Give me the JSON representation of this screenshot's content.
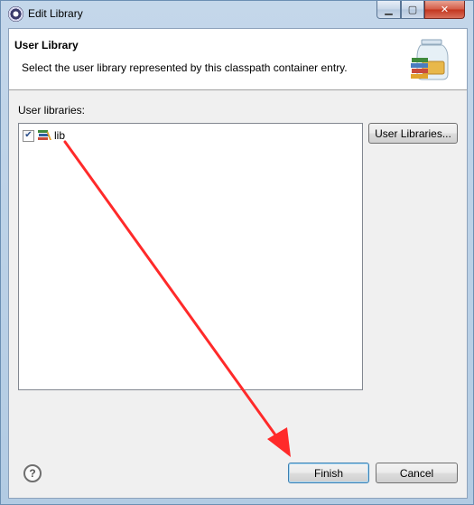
{
  "window": {
    "title": "Edit Library",
    "app_icon": "eclipse-icon",
    "controls": {
      "minimize": "minimize-icon",
      "maximize": "maximize-icon",
      "close": "close-icon"
    }
  },
  "header": {
    "title": "User Library",
    "message": "Select the user library represented by this classpath container entry.",
    "image": "library-jar-icon"
  },
  "libraries": {
    "label": "User libraries:",
    "items": [
      {
        "name": "lib",
        "checked": true,
        "icon": "library-icon"
      }
    ],
    "user_libraries_button": "User Libraries..."
  },
  "footer": {
    "help_icon": "help-icon",
    "finish_label": "Finish",
    "cancel_label": "Cancel"
  },
  "annotation": {
    "type": "red-arrow",
    "from": "lib",
    "to": "Finish",
    "color": "#ff2a2a"
  },
  "colors": {
    "titlebar": "#c4d7ea",
    "close_button": "#c2351e",
    "dialog_bg": "#f0f0f0",
    "header_bg": "#ffffff"
  }
}
